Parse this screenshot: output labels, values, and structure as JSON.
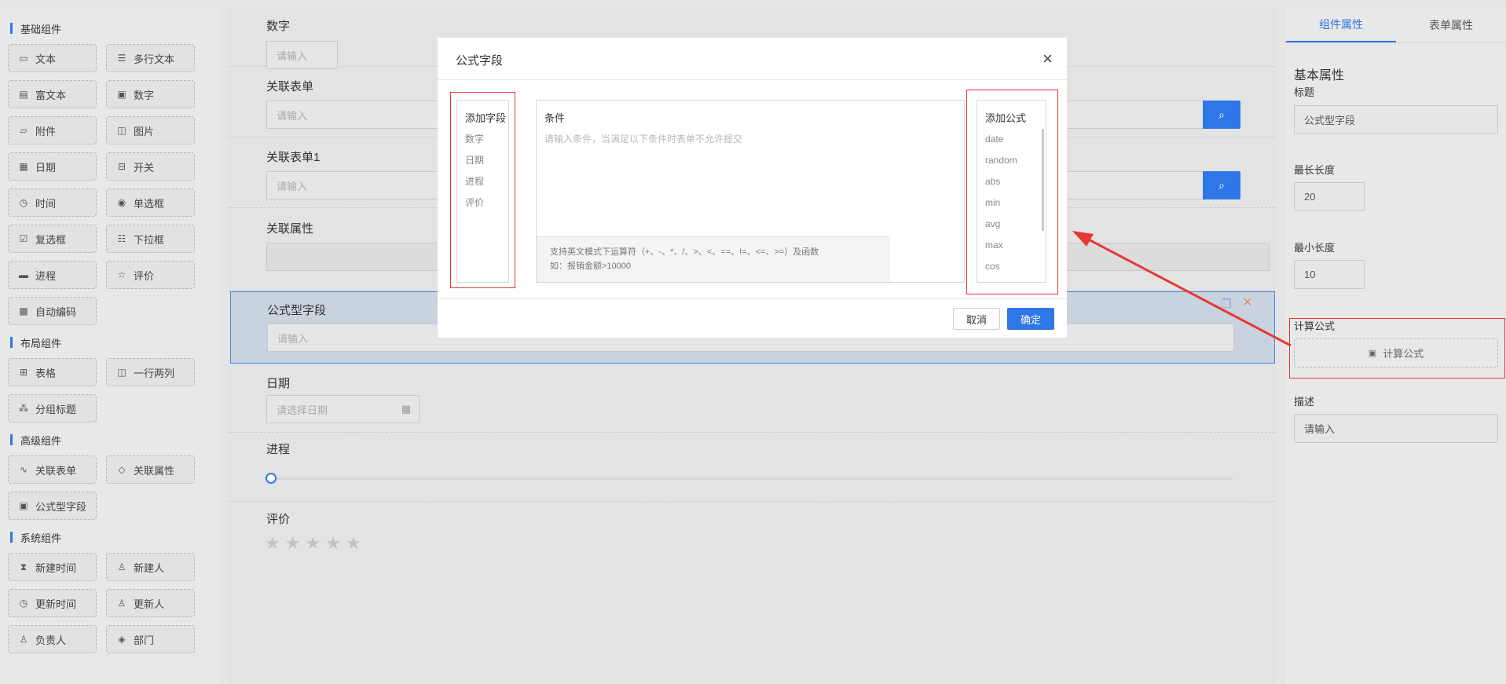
{
  "left": {
    "groups": [
      {
        "title": "基础组件",
        "items": [
          {
            "label": "文本",
            "icon": "text-icon"
          },
          {
            "label": "多行文本",
            "icon": "textarea-icon"
          },
          {
            "label": "富文本",
            "icon": "richtext-icon"
          },
          {
            "label": "数字",
            "icon": "number-icon"
          },
          {
            "label": "附件",
            "icon": "folder-icon"
          },
          {
            "label": "图片",
            "icon": "image-icon"
          },
          {
            "label": "日期",
            "icon": "calendar-icon"
          },
          {
            "label": "开关",
            "icon": "switch-icon"
          },
          {
            "label": "时间",
            "icon": "clock-icon"
          },
          {
            "label": "单选框",
            "icon": "radio-icon"
          },
          {
            "label": "复选框",
            "icon": "checkbox-icon"
          },
          {
            "label": "下拉框",
            "icon": "select-icon"
          },
          {
            "label": "进程",
            "icon": "progress-icon"
          },
          {
            "label": "评价",
            "icon": "star-icon"
          },
          {
            "label": "自动编码",
            "icon": "code-icon"
          }
        ]
      },
      {
        "title": "布局组件",
        "items": [
          {
            "label": "表格",
            "icon": "table-icon"
          },
          {
            "label": "一行两列",
            "icon": "columns-icon"
          },
          {
            "label": "分组标题",
            "icon": "group-icon"
          }
        ]
      },
      {
        "title": "高级组件",
        "items": [
          {
            "label": "关联表单",
            "icon": "link-icon"
          },
          {
            "label": "关联属性",
            "icon": "tag-icon"
          },
          {
            "label": "公式型字段",
            "icon": "formula-icon"
          }
        ]
      },
      {
        "title": "系统组件",
        "items": [
          {
            "label": "新建时间",
            "icon": "hourglass-icon"
          },
          {
            "label": "新建人",
            "icon": "user-icon"
          },
          {
            "label": "更新时间",
            "icon": "clock-icon"
          },
          {
            "label": "更新人",
            "icon": "user-icon"
          },
          {
            "label": "负责人",
            "icon": "user-icon"
          },
          {
            "label": "部门",
            "icon": "dept-icon"
          }
        ]
      }
    ]
  },
  "center": {
    "number": {
      "label": "数字",
      "placeholder": "请输入"
    },
    "relform": {
      "label": "关联表单",
      "placeholder": "请输入"
    },
    "relform1": {
      "label": "关联表单1",
      "placeholder": "请输入"
    },
    "relattr": {
      "label": "关联属性"
    },
    "formula": {
      "label": "公式型字段",
      "placeholder": "请输入"
    },
    "date": {
      "label": "日期",
      "placeholder": "请选择日期"
    },
    "progress": {
      "label": "进程",
      "value": 0
    },
    "rating": {
      "label": "评价",
      "max": 5,
      "value": 0
    }
  },
  "right": {
    "tabs": [
      "组件属性",
      "表单属性"
    ],
    "section_title": "基本属性",
    "title_label": "标题",
    "title_value": "公式型字段",
    "maxlen_label": "最长长度",
    "maxlen_value": "20",
    "minlen_label": "最小长度",
    "minlen_value": "10",
    "formula_label": "计算公式",
    "formula_button": "计算公式",
    "desc_label": "描述",
    "desc_placeholder": "请输入"
  },
  "modal": {
    "title": "公式字段",
    "fields_head": "添加字段",
    "fields": [
      "数字",
      "日期",
      "进程",
      "评价"
    ],
    "condition_label": "条件",
    "condition_placeholder": "请输入条件，当满足以下条件时表单不允许提交",
    "hint_line1": "支持英文模式下运算符（+、-、*、/、>、<、==、!=、<=、>=）及函数",
    "hint_line2": "如：报销金额>10000",
    "formulas_head": "添加公式",
    "formulas": [
      "date",
      "random",
      "abs",
      "min",
      "avg",
      "max",
      "cos"
    ],
    "cancel": "取消",
    "confirm": "确定"
  },
  "colors": {
    "accent": "#2f77e6",
    "highlight": "#e53935"
  }
}
